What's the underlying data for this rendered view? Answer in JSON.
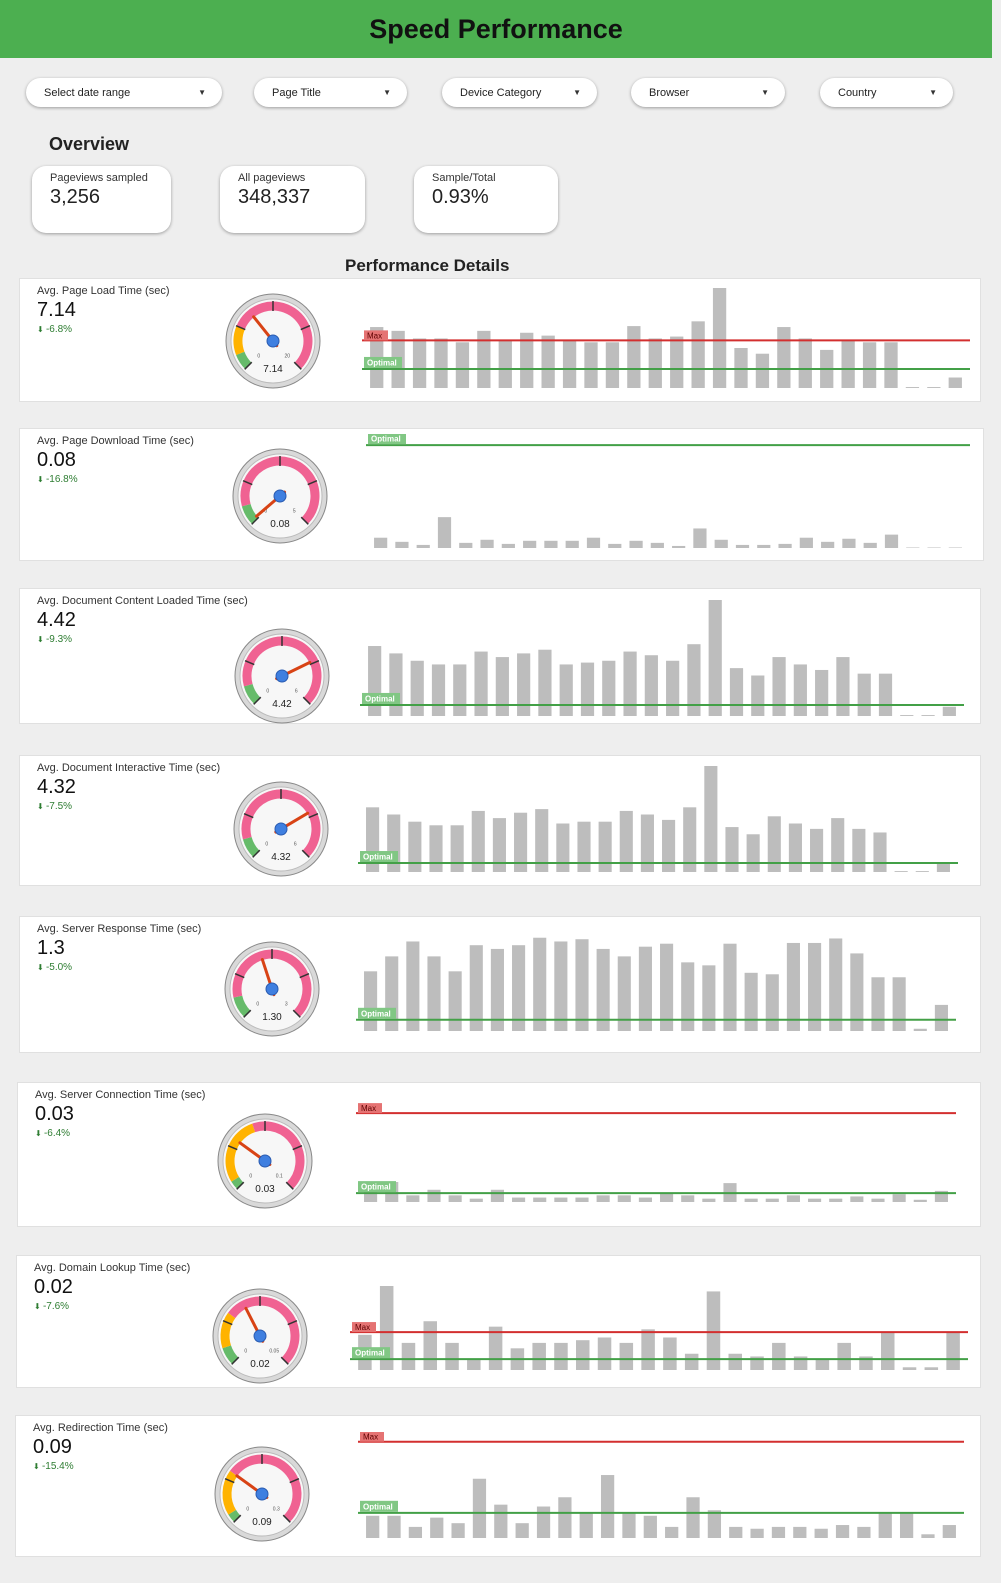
{
  "title": "Speed Performance",
  "filters": [
    {
      "label": "Select date range"
    },
    {
      "label": "Page Title"
    },
    {
      "label": "Device Category"
    },
    {
      "label": "Browser"
    },
    {
      "label": "Country"
    }
  ],
  "overview": {
    "title": "Overview",
    "cards": [
      {
        "label": "Pageviews sampled",
        "value": "3,256"
      },
      {
        "label": "All pageviews",
        "value": "348,337"
      },
      {
        "label": "Sample/Total",
        "value": "0.93%"
      }
    ]
  },
  "details_title": "Performance Details",
  "colors": {
    "header": "#4caf50",
    "bar": "#bdbdbd",
    "max_line": "#d32f2f",
    "optimal_line": "#43a047",
    "gauge_red": "#f06292",
    "gauge_yellow": "#ffb300",
    "gauge_green": "#66bb6a",
    "needle": "#d84315",
    "hub": "#3f7fe0",
    "delta_down": "#2e7d32"
  },
  "metrics": [
    {
      "label": "Avg. Page Load Time (sec)",
      "value": "7.14",
      "delta": "-6.8%",
      "gauge": {
        "display": "7.14",
        "min_label": "0",
        "max_label": "20",
        "fraction": 0.357,
        "green": 0.09,
        "yellow": 0.16
      },
      "max_label": "Max",
      "optimal_label": "Optimal",
      "max_level": 5.0,
      "optimal_level": 2.0,
      "chart_data": {
        "type": "bar",
        "ymax": 10.5,
        "values": [
          6.4,
          6.0,
          5.2,
          5.2,
          4.8,
          6.0,
          5.0,
          5.8,
          5.5,
          5.0,
          4.8,
          4.8,
          6.5,
          5.2,
          5.4,
          7.0,
          10.5,
          4.2,
          3.6,
          6.4,
          5.2,
          4.0,
          5.0,
          4.8,
          4.8,
          0.1,
          0.1,
          1.1
        ]
      }
    },
    {
      "label": "Avg. Page Download Time (sec)",
      "value": "0.08",
      "delta": "-16.8%",
      "gauge": {
        "display": "0.08",
        "min_label": "0",
        "max_label": "5",
        "fraction": 0.016,
        "green": 0.11,
        "yellow": 0
      },
      "max_label": "",
      "optimal_label": "Optimal",
      "max_level": null,
      "optimal_level": 1.0,
      "chart_data": {
        "type": "bar",
        "ymax": 1.05,
        "values": [
          0.1,
          0.06,
          0.03,
          0.3,
          0.05,
          0.08,
          0.04,
          0.07,
          0.07,
          0.07,
          0.1,
          0.04,
          0.07,
          0.05,
          0.02,
          0.19,
          0.08,
          0.03,
          0.03,
          0.04,
          0.1,
          0.06,
          0.09,
          0.05,
          0.13,
          0.004,
          0.004,
          0.004
        ]
      }
    },
    {
      "label": "Avg. Document Content Loaded Time (sec)",
      "value": "4.42",
      "delta": "-9.3%",
      "gauge": {
        "display": "4.42",
        "min_label": "0",
        "max_label": "6",
        "fraction": 0.737,
        "green": 0.11,
        "yellow": 0
      },
      "max_label": "",
      "optimal_label": "Optimal",
      "max_level": null,
      "optimal_level": 0.6,
      "chart_data": {
        "type": "bar",
        "ymax": 6.3,
        "values": [
          3.8,
          3.4,
          3.0,
          2.8,
          2.8,
          3.5,
          3.2,
          3.4,
          3.6,
          2.8,
          2.9,
          3.0,
          3.5,
          3.3,
          3.0,
          3.9,
          6.3,
          2.6,
          2.2,
          3.2,
          2.8,
          2.5,
          3.2,
          2.3,
          2.3,
          0.05,
          0.05,
          0.5
        ]
      }
    },
    {
      "label": "Avg. Document Interactive Time (sec)",
      "value": "4.32",
      "delta": "-7.5%",
      "gauge": {
        "display": "4.32",
        "min_label": "0",
        "max_label": "6",
        "fraction": 0.72,
        "green": 0.11,
        "yellow": 0
      },
      "max_label": "",
      "optimal_label": "Optimal",
      "max_level": null,
      "optimal_level": 0.5,
      "chart_data": {
        "type": "bar",
        "ymax": 5.9,
        "values": [
          3.6,
          3.2,
          2.8,
          2.6,
          2.6,
          3.4,
          3.0,
          3.3,
          3.5,
          2.7,
          2.8,
          2.8,
          3.4,
          3.2,
          2.9,
          3.6,
          5.9,
          2.5,
          2.1,
          3.1,
          2.7,
          2.4,
          3.0,
          2.4,
          2.2,
          0.05,
          0.05,
          0.5
        ]
      }
    },
    {
      "label": "Avg. Server Response Time (sec)",
      "value": "1.3",
      "delta": "-5.0%",
      "gauge": {
        "display": "1.30",
        "min_label": "0",
        "max_label": "3",
        "fraction": 0.433,
        "green": 0.12,
        "yellow": 0
      },
      "max_label": "",
      "optimal_label": "Optimal",
      "max_level": null,
      "optimal_level": 0.15,
      "chart_data": {
        "type": "bar",
        "ymax": 1.3,
        "values": [
          0.8,
          1.0,
          1.2,
          1.0,
          0.8,
          1.15,
          1.1,
          1.15,
          1.25,
          1.2,
          1.23,
          1.1,
          1.0,
          1.13,
          1.17,
          0.92,
          0.88,
          1.17,
          0.78,
          0.76,
          1.18,
          1.18,
          1.24,
          1.04,
          0.72,
          0.72,
          0.03,
          0.35
        ]
      }
    },
    {
      "label": "Avg. Server Connection Time (sec)",
      "value": "0.03",
      "delta": "-6.4%",
      "gauge": {
        "display": "0.03",
        "min_label": "0",
        "max_label": "0.1",
        "fraction": 0.3,
        "green": 0.05,
        "yellow": 0.38
      },
      "max_label": "Max",
      "optimal_label": "Optimal",
      "max_level": 0.08,
      "optimal_level": 0.008,
      "chart_data": {
        "type": "bar",
        "ymax": 0.09,
        "values": [
          0.01,
          0.018,
          0.006,
          0.011,
          0.006,
          0.003,
          0.011,
          0.004,
          0.004,
          0.004,
          0.004,
          0.006,
          0.006,
          0.004,
          0.008,
          0.006,
          0.003,
          0.017,
          0.003,
          0.003,
          0.006,
          0.003,
          0.003,
          0.005,
          0.003,
          0.007,
          0.002,
          0.01
        ]
      }
    },
    {
      "label": "Avg. Domain Lookup Time (sec)",
      "value": "0.02",
      "delta": "-7.6%",
      "gauge": {
        "display": "0.02",
        "min_label": "0",
        "max_label": "0.05",
        "fraction": 0.4,
        "green": 0.1,
        "yellow": 0.2
      },
      "max_label": "Max",
      "optimal_label": "Optimal",
      "max_level": 0.014,
      "optimal_level": 0.004,
      "chart_data": {
        "type": "bar",
        "ymax": 0.031,
        "values": [
          0.013,
          0.031,
          0.01,
          0.018,
          0.01,
          0.004,
          0.016,
          0.008,
          0.01,
          0.01,
          0.011,
          0.012,
          0.01,
          0.015,
          0.012,
          0.006,
          0.029,
          0.006,
          0.005,
          0.01,
          0.005,
          0.004,
          0.01,
          0.005,
          0.014,
          0.001,
          0.001,
          0.014
        ]
      }
    },
    {
      "label": "Avg. Redirection Time (sec)",
      "value": "0.09",
      "delta": "-15.4%",
      "gauge": {
        "display": "0.09",
        "min_label": "0",
        "max_label": "0.3",
        "fraction": 0.3,
        "green": 0.05,
        "yellow": 0.25
      },
      "max_label": "Max",
      "optimal_label": "Optimal",
      "max_level": 0.26,
      "optimal_level": 0.068,
      "chart_data": {
        "type": "bar",
        "ymax": 0.27,
        "values": [
          0.06,
          0.06,
          0.03,
          0.055,
          0.04,
          0.16,
          0.09,
          0.04,
          0.085,
          0.11,
          0.07,
          0.17,
          0.07,
          0.06,
          0.03,
          0.11,
          0.075,
          0.03,
          0.025,
          0.03,
          0.03,
          0.025,
          0.035,
          0.03,
          0.07,
          0.07,
          0.01,
          0.035
        ]
      }
    }
  ]
}
